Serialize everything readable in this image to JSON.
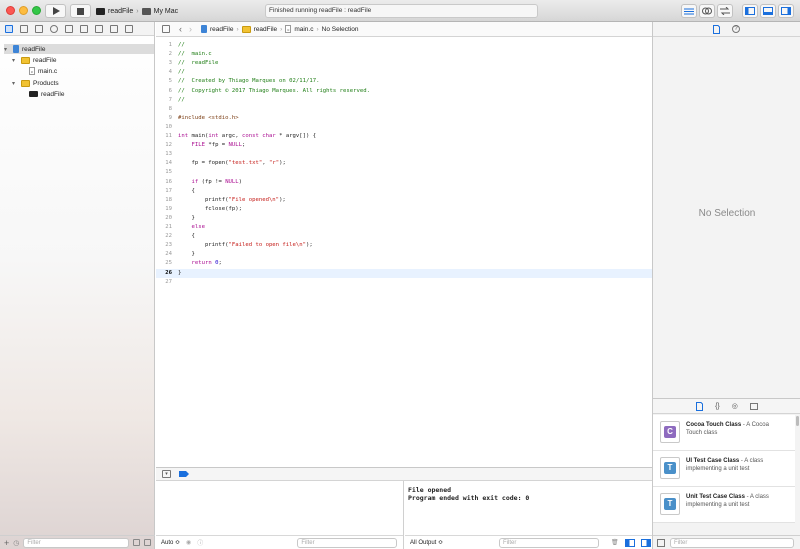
{
  "toolbar": {
    "scheme_target": "readFile",
    "scheme_device": "My Mac",
    "activity_status": "Finished running readFile : readFile"
  },
  "navigator": {
    "tree": [
      {
        "label": "readFile",
        "kind": "project",
        "level": 0,
        "expanded": true,
        "selected": true
      },
      {
        "label": "readFile",
        "kind": "folder",
        "level": 1,
        "expanded": true
      },
      {
        "label": "main.c",
        "kind": "c-file",
        "level": 2
      },
      {
        "label": "Products",
        "kind": "folder",
        "level": 1,
        "expanded": true
      },
      {
        "label": "readFile",
        "kind": "product",
        "level": 2
      }
    ],
    "filter_placeholder": "Filter"
  },
  "jumpbar": {
    "crumbs": [
      "readFile",
      "readFile",
      "main.c",
      "No Selection"
    ]
  },
  "editor": {
    "current_line": 26,
    "lines": [
      "//",
      "//  main.c",
      "//  readFile",
      "//",
      "//  Created by Thiago Marques on 02/11/17.",
      "//  Copyright © 2017 Thiago Marques. All rights reserved.",
      "//",
      "",
      "#include <stdio.h>",
      "",
      "int main(int argc, const char * argv[]) {",
      "    FILE *fp = NULL;",
      "",
      "    fp = fopen(\"test.txt\", \"r\");",
      "",
      "    if (fp != NULL)",
      "    {",
      "        printf(\"File opened\\n\");",
      "        fclose(fp);",
      "    }",
      "    else",
      "    {",
      "        printf(\"Failed to open file\\n\");",
      "    }",
      "    return 0;",
      "}",
      ""
    ]
  },
  "debug": {
    "vars_scope": "Auto ≎",
    "vars_filter_placeholder": "Filter",
    "console_lines": [
      "File opened",
      "Program ended with exit code: 0"
    ],
    "console_output_select": "All Output ≎",
    "console_filter_placeholder": "Filter"
  },
  "inspector": {
    "no_selection": "No Selection"
  },
  "library": {
    "items": [
      {
        "title": "Cocoa Touch Class",
        "desc": " - A Cocoa Touch class",
        "badge": "C",
        "color": "#8e6bbf"
      },
      {
        "title": "UI Test Case Class",
        "desc": " - A class implementing a unit test",
        "badge": "T",
        "color": "#4a90c9"
      },
      {
        "title": "Unit Test Case Class",
        "desc": " - A class implementing a unit test",
        "badge": "T",
        "color": "#4a90c9"
      }
    ],
    "filter_placeholder": "Filter"
  }
}
